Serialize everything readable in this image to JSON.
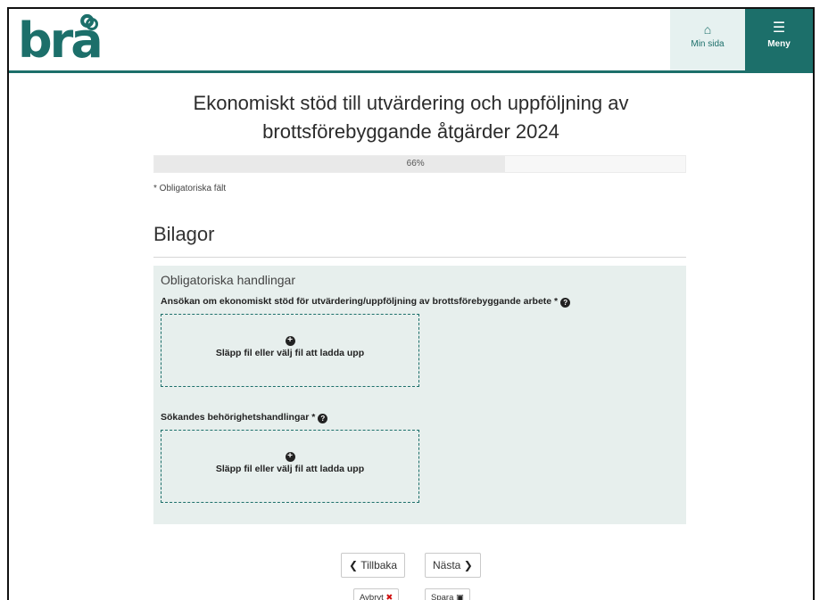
{
  "header": {
    "logo_text": "brå",
    "minsida_icon": "home-icon",
    "minsida_label": "Min sida",
    "menu_icon": "hamburger-icon",
    "menu_label": "Meny"
  },
  "form": {
    "title_line1": "Ekonomiskt stöd till utvärdering och uppföljning av",
    "title_line2": "brottsförebyggande åtgärder 2024",
    "progress_percent": 66,
    "progress_label": "66%",
    "required_note": "* Obligatoriska fält",
    "section_title": "Bilagor",
    "panel_title": "Obligatoriska handlingar",
    "fields": [
      {
        "label": "Ansökan om ekonomiskt stöd för utvärdering/uppföljning av brottsförebyggande arbete *",
        "dropzone_text": "Släpp fil eller välj fil att ladda upp"
      },
      {
        "label": "Sökandes behörighetshandlingar *",
        "dropzone_text": "Släpp fil eller välj fil att ladda upp"
      }
    ]
  },
  "buttons": {
    "back": "Tillbaka",
    "next": "Nästa",
    "cancel": "Avbryt",
    "save": "Spara"
  },
  "colors": {
    "brand": "#1c6f6a",
    "panel_bg": "#e7efed",
    "cancel_icon": "#d01010"
  }
}
